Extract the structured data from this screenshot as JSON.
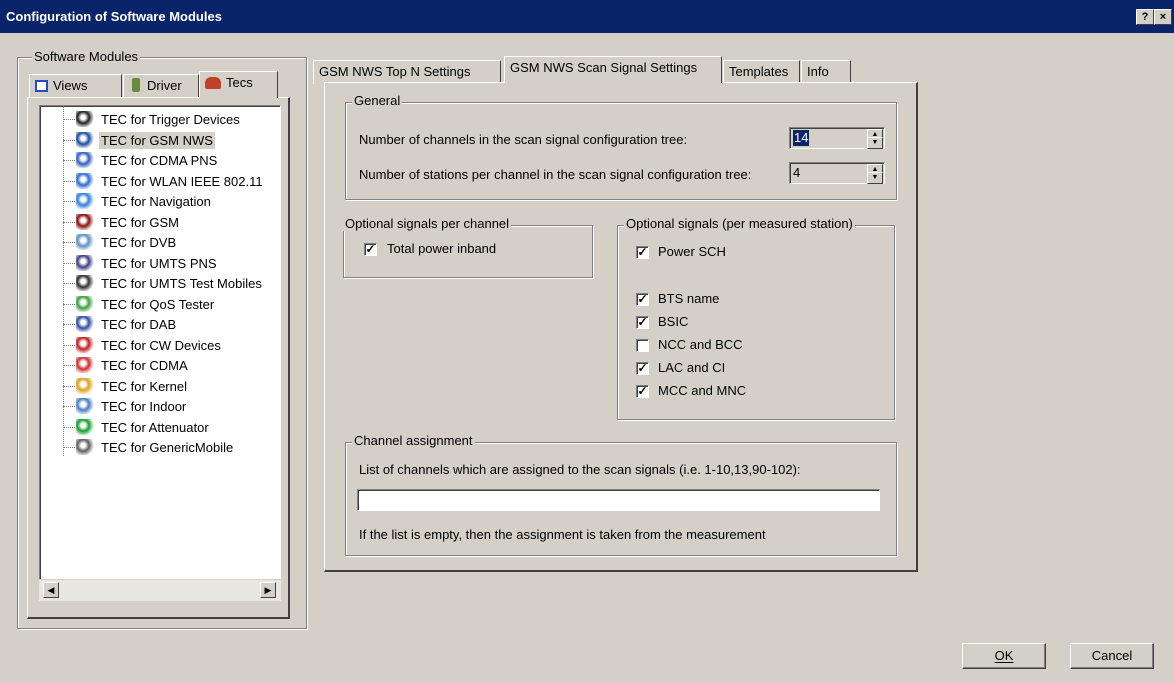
{
  "window": {
    "title": "Configuration of Software Modules",
    "help_label": "?",
    "close_label": "×"
  },
  "left": {
    "group_label": "Software Modules",
    "tabs": [
      {
        "label": "Views"
      },
      {
        "label": "Driver"
      },
      {
        "label": "Tecs"
      }
    ],
    "tree_items": [
      {
        "label": "TEC for Trigger Devices",
        "icon": "trigger-devices-icon"
      },
      {
        "label": "TEC for GSM NWS",
        "icon": "gsm-nws-icon"
      },
      {
        "label": "TEC for CDMA PNS",
        "icon": "cdma-pns-icon"
      },
      {
        "label": "TEC for WLAN IEEE 802.11",
        "icon": "wlan-icon"
      },
      {
        "label": "TEC for Navigation",
        "icon": "navigation-icon"
      },
      {
        "label": "TEC for GSM",
        "icon": "gsm-icon"
      },
      {
        "label": "TEC for DVB",
        "icon": "dvb-icon"
      },
      {
        "label": "TEC for UMTS PNS",
        "icon": "umts-pns-icon"
      },
      {
        "label": "TEC for UMTS Test Mobiles",
        "icon": "umts-test-mobiles-icon"
      },
      {
        "label": "TEC for QoS Tester",
        "icon": "qos-tester-icon"
      },
      {
        "label": "TEC for DAB",
        "icon": "dab-icon"
      },
      {
        "label": "TEC for CW Devices",
        "icon": "cw-devices-icon"
      },
      {
        "label": "TEC for CDMA",
        "icon": "cdma-icon"
      },
      {
        "label": "TEC for Kernel",
        "icon": "kernel-icon"
      },
      {
        "label": "TEC for Indoor",
        "icon": "indoor-icon"
      },
      {
        "label": "TEC for Attenuator",
        "icon": "attenuator-icon"
      },
      {
        "label": "TEC for GenericMobile",
        "icon": "generic-mobile-icon"
      }
    ],
    "selected_index": 1
  },
  "right": {
    "tabs": [
      {
        "label": "GSM NWS Top N Settings"
      },
      {
        "label": "GSM NWS Scan Signal Settings"
      },
      {
        "label": "Templates"
      },
      {
        "label": "Info"
      }
    ],
    "general": {
      "label": "General",
      "channels_label": "Number of channels in the scan signal configuration tree:",
      "channels_value": "14",
      "stations_label": "Number of stations per channel in the scan signal configuration tree:",
      "stations_value": "4"
    },
    "optional_channel": {
      "label": "Optional signals per channel",
      "total_power_label": "Total power inband",
      "total_power_checked": true
    },
    "optional_station": {
      "label": "Optional signals (per measured station)",
      "items": [
        {
          "label": "Power SCH",
          "checked": true
        },
        {
          "label": "BTS name",
          "checked": true
        },
        {
          "label": "BSIC",
          "checked": true
        },
        {
          "label": "NCC and BCC",
          "checked": false
        },
        {
          "label": "LAC and CI",
          "checked": true
        },
        {
          "label": "MCC and MNC",
          "checked": true
        }
      ]
    },
    "channel_assignment": {
      "label": "Channel assignment",
      "list_label": "List of channels which are assigned to the scan signals (i.e. 1-10,13,90-102):",
      "list_value": "",
      "note": "If the list is empty, then the assignment is taken from the measurement"
    }
  },
  "buttons": {
    "ok_label": "OK",
    "cancel_label": "Cancel"
  }
}
